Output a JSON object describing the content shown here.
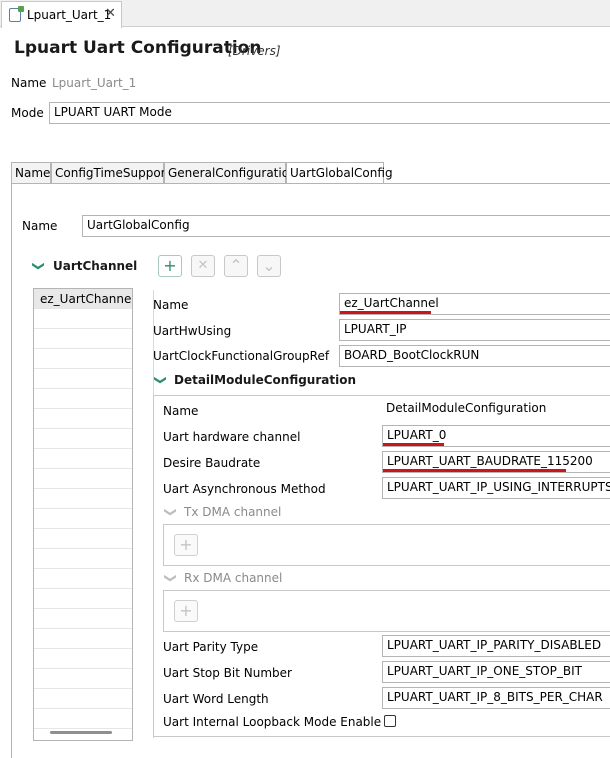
{
  "editor_tab": {
    "label": "Lpuart_Uart_1",
    "close": "✕"
  },
  "header": {
    "title": "Lpuart Uart Configuration",
    "subtitle": "[Drivers]"
  },
  "name_row": {
    "label": "Name",
    "value": "Lpuart_Uart_1"
  },
  "mode_row": {
    "label": "Mode",
    "value": "LPUART UART Mode"
  },
  "config_tabs": [
    "Name",
    "ConfigTimeSupport",
    "GeneralConfiguration",
    "UartGlobalConfig"
  ],
  "global_config": {
    "name_label": "Name",
    "name_value": "UartGlobalConfig"
  },
  "uart_channel": {
    "title": "UartChannel",
    "toolbar": {
      "add": "+",
      "remove": "✕",
      "up": "⌃",
      "down": "⌄"
    },
    "list": [
      "ez_UartChannel"
    ],
    "fields": [
      {
        "label": "Name",
        "value": "ez_UartChannel"
      },
      {
        "label": "UartHwUsing",
        "value": "LPUART_IP"
      },
      {
        "label": "UartClockFunctionalGroupRef",
        "value": "BOARD_BootClockRUN"
      }
    ]
  },
  "detail_module": {
    "title": "DetailModuleConfiguration",
    "fields": [
      {
        "label": "Name",
        "value": "DetailModuleConfiguration"
      },
      {
        "label": "Uart hardware channel",
        "value": "LPUART_0"
      },
      {
        "label": "Desire Baudrate",
        "value": "LPUART_UART_BAUDRATE_115200"
      },
      {
        "label": "Uart Asynchronous Method",
        "value": "LPUART_UART_IP_USING_INTERRUPTS"
      }
    ],
    "tx_dma": {
      "title": "Tx DMA channel",
      "add": "+"
    },
    "rx_dma": {
      "title": "Rx DMA channel",
      "add": "+"
    },
    "fields2": [
      {
        "label": "Uart Parity Type",
        "value": "LPUART_UART_IP_PARITY_DISABLED"
      },
      {
        "label": "Uart Stop Bit Number",
        "value": "LPUART_UART_IP_ONE_STOP_BIT"
      },
      {
        "label": "Uart Word Length",
        "value": "LPUART_UART_IP_8_BITS_PER_CHAR"
      }
    ],
    "loopback": {
      "label": "Uart Internal Loopback Mode Enable",
      "checked": false
    }
  },
  "colors": {
    "accent": "#2b8b6b",
    "highlight_underline": "#d0121b"
  }
}
